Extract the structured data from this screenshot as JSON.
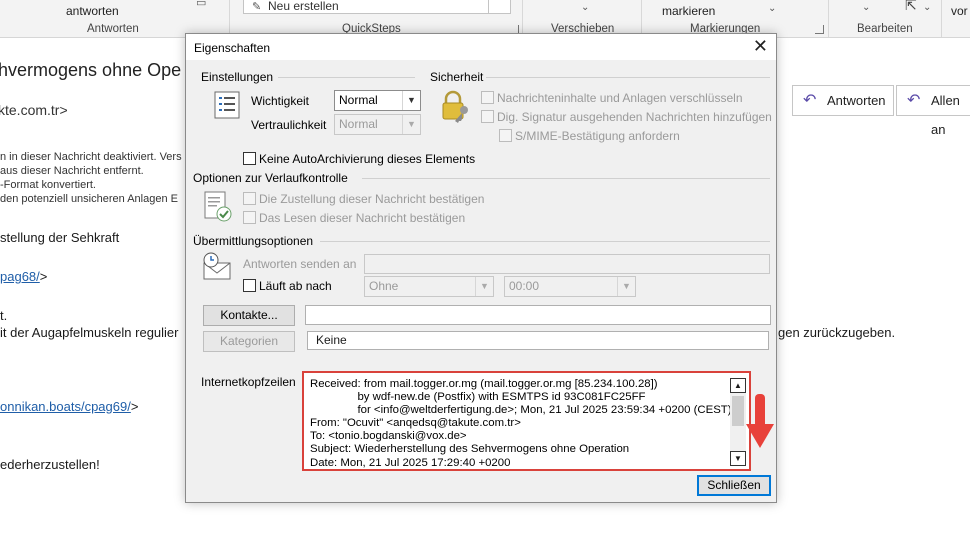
{
  "ribbon": {
    "antworten_btn": "antworten",
    "group_antworten": "Antworten",
    "quicksteps_item": "Neu erstellen",
    "group_quicksteps": "QuickSteps",
    "group_verschieben": "Verschieben",
    "markieren_btn": "markieren",
    "group_markierungen": "Markierungen",
    "group_bearbeiten": "Bearbeiten",
    "vor_btn": "vor"
  },
  "mail": {
    "subject_fragment": "hvermogens ohne Ope",
    "sender_fragment": "kte.com.tr>",
    "info_lines": [
      "n in dieser Nachricht deaktiviert. Vers",
      "aus dieser Nachricht entfernt.",
      "-Format konvertiert.",
      "den potenziell unsicheren Anlagen E"
    ],
    "body_line1": "stellung der Sehkraft",
    "link1": "pag68/",
    "link1_suffix": ">",
    "body_dot": "t.",
    "body_line3_left": "it der Augapfelmuskeln regulier",
    "body_line3_right": "gen zurückzugeben.",
    "link2": "onnikan.boats/cpag69/",
    "link2_suffix": ">",
    "body_line4": "ederherzustellen!",
    "reply_button": "Antworten",
    "reply_all_button": "Allen an"
  },
  "dialog": {
    "title": "Eigenschaften",
    "settings": {
      "heading": "Einstellungen",
      "importance_label": "Wichtigkeit",
      "importance_value": "Normal",
      "sensitivity_label": "Vertraulichkeit",
      "sensitivity_value": "Normal",
      "no_autoarchive": "Keine AutoArchivierung dieses Elements"
    },
    "security": {
      "heading": "Sicherheit",
      "encrypt": "Nachrichteninhalte und Anlagen verschlüsseln",
      "sign": "Dig. Signatur ausgehenden Nachrichten hinzufügen",
      "smime": "S/MIME-Bestätigung anfordern"
    },
    "tracking": {
      "heading": "Optionen zur Verlaufkontrolle",
      "delivery": "Die Zustellung dieser Nachricht bestätigen",
      "read": "Das Lesen dieser Nachricht bestätigen"
    },
    "delivery": {
      "heading": "Übermittlungsoptionen",
      "reply_to_label": "Antworten senden an",
      "expires_label": "Läuft ab nach",
      "expires_date": "Ohne",
      "expires_time": "00:00"
    },
    "contacts_button": "Kontakte...",
    "categories_button": "Kategorien",
    "categories_value": "Keine",
    "headers_label": "Internetkopfzeilen",
    "headers_text": "Received: from mail.togger.or.mg (mail.togger.or.mg [85.234.100.28])\n               by wdf-new.de (Postfix) with ESMTPS id 93C081FC25FF\n               for <info@weltderfertigung.de>; Mon, 21 Jul 2025 23:59:34 +0200 (CEST)\nFrom: \"Ocuvit\" <anqedsq@takute.com.tr>\nTo: <tonio.bogdanski@vox.de>\nSubject: Wiederherstellung des Sehvermogens ohne Operation\nDate: Mon, 21 Jul 2025 17:29:40 +0200",
    "close_button": "Schließen"
  },
  "colors": {
    "highlight_box": "#d9423b",
    "arrow": "#e8413a",
    "link": "#1f5ea8"
  }
}
